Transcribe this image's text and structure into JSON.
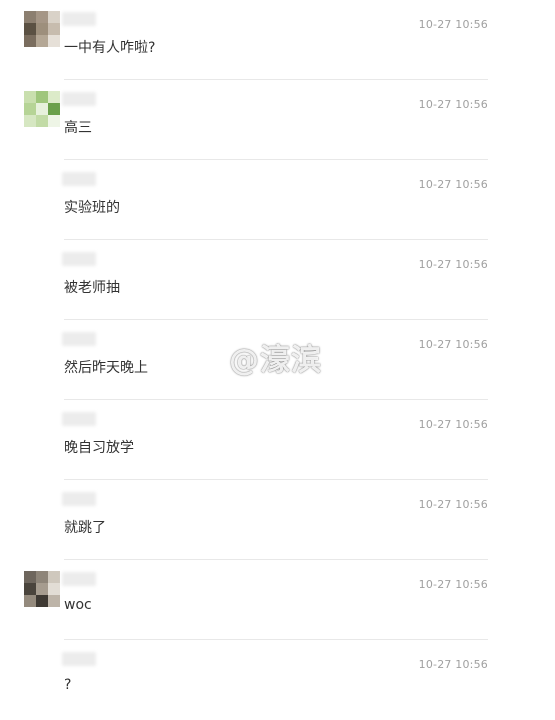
{
  "comments": [
    {
      "time": "10-27 10:56",
      "text": "一中有人咋啦?"
    },
    {
      "time": "10-27 10:56",
      "text": "高三"
    },
    {
      "time": "10-27 10:56",
      "text": "实验班的"
    },
    {
      "time": "10-27 10:56",
      "text": "被老师抽"
    },
    {
      "time": "10-27 10:56",
      "text": "然后昨天晚上"
    },
    {
      "time": "10-27 10:56",
      "text": "晚自习放学"
    },
    {
      "time": "10-27 10:56",
      "text": "就跳了"
    },
    {
      "time": "10-27 10:56",
      "text": "woc"
    },
    {
      "time": "10-27 10:56",
      "text": "?"
    }
  ],
  "watermark": "@濠滨"
}
